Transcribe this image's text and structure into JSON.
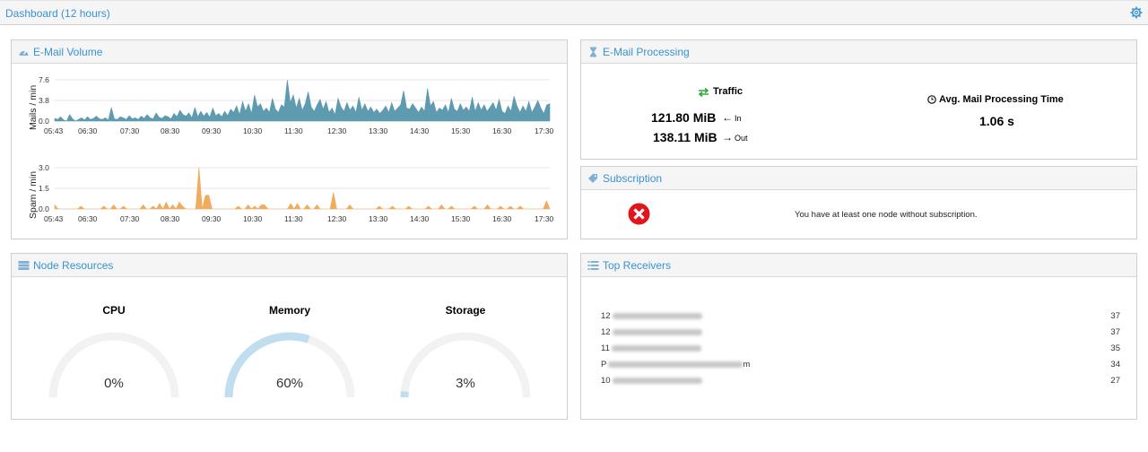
{
  "topbar": {
    "title": "Dashboard (12 hours)",
    "settings_icon": "gear-icon"
  },
  "panels": {
    "volume": {
      "title": "E-Mail Volume",
      "icon": "tachometer-icon"
    },
    "processing": {
      "title": "E-Mail Processing",
      "icon": "hourglass-icon"
    },
    "subscription": {
      "title": "Subscription",
      "icon": "ticket-icon"
    },
    "resources": {
      "title": "Node Resources",
      "icon": "server-icon"
    },
    "receivers": {
      "title": "Top Receivers",
      "icon": "list-icon"
    }
  },
  "chart_data": [
    {
      "type": "area",
      "ylabel": "Mails / min",
      "ylim": [
        0,
        7.6
      ],
      "yticks": [
        "7.6",
        "3.8",
        "0.0"
      ],
      "xticks": [
        "05:43",
        "06:30",
        "07:30",
        "08:30",
        "09:30",
        "10:30",
        "11:30",
        "12:30",
        "13:30",
        "14:30",
        "15:30",
        "16:30",
        "17:30"
      ],
      "color": "#5e9ab0",
      "values": [
        0.5,
        0.3,
        0.8,
        0.2,
        0.0,
        1.2,
        0.4,
        0.0,
        0.3,
        0.6,
        0.2,
        0.8,
        0.3,
        0.5,
        0.9,
        0.4,
        0.3,
        0.6,
        0.2,
        2.5,
        0.4,
        0.3,
        0.8,
        0.6,
        0.3,
        1.0,
        0.4,
        0.6,
        0.3,
        0.9,
        0.5,
        1.2,
        0.6,
        0.4,
        1.5,
        0.7,
        0.5,
        1.0,
        0.8,
        0.4,
        1.4,
        0.8,
        2.0,
        1.2,
        0.9,
        1.5,
        0.6,
        2.5,
        0.8,
        1.8,
        0.9,
        1.6,
        0.7,
        2.4,
        1.0,
        1.4,
        0.8,
        1.8,
        1.0,
        2.2,
        1.6,
        2.8,
        1.2,
        3.6,
        1.8,
        3.2,
        1.4,
        4.8,
        2.6,
        3.2,
        1.8,
        2.4,
        1.6,
        4.2,
        2.2,
        1.6,
        3.0,
        2.6,
        7.6,
        3.4,
        4.8,
        2.4,
        4.2,
        2.0,
        3.2,
        5.4,
        2.6,
        1.8,
        3.0,
        4.0,
        2.2,
        3.6,
        1.6,
        2.4,
        1.2,
        4.2,
        2.6,
        1.8,
        3.4,
        2.0,
        2.8,
        1.6,
        4.4,
        2.0,
        3.2,
        1.8,
        2.6,
        1.6,
        2.2,
        1.4,
        2.0,
        2.8,
        1.6,
        3.4,
        1.8,
        2.4,
        3.0,
        5.6,
        2.4,
        2.2,
        3.2,
        2.4,
        1.6,
        2.6,
        1.8,
        6.0,
        2.8,
        3.6,
        1.6,
        2.4,
        2.0,
        3.0,
        1.6,
        4.2,
        2.2,
        1.8,
        3.2,
        2.0,
        2.6,
        1.8,
        4.4,
        1.8,
        3.4,
        2.0,
        3.0,
        1.8,
        2.6,
        3.4,
        2.0,
        4.0,
        1.8,
        1.4,
        2.8,
        1.8,
        4.6,
        2.8,
        1.6,
        2.8,
        1.8,
        3.6,
        1.6,
        2.6,
        3.8,
        2.4,
        1.4,
        3.0,
        3.2
      ],
      "title": ""
    },
    {
      "type": "area",
      "ylabel": "Spam / min",
      "ylim": [
        0,
        3.0
      ],
      "yticks": [
        "3.0",
        "1.5",
        "0.0"
      ],
      "xticks": [
        "05:43",
        "06:30",
        "07:30",
        "08:30",
        "09:30",
        "10:30",
        "11:30",
        "12:30",
        "13:30",
        "14:30",
        "15:30",
        "16:30",
        "17:30"
      ],
      "color": "#f0ab5c",
      "values": [
        0.3,
        0,
        0,
        0,
        0,
        0,
        0,
        0,
        0.2,
        0,
        0,
        0,
        0,
        0,
        0,
        0.2,
        0,
        0,
        0.3,
        0,
        0,
        0.2,
        0,
        0,
        0,
        0,
        0,
        0.3,
        0,
        0,
        0.2,
        0,
        0.4,
        0,
        0.5,
        0,
        0.3,
        0,
        0.5,
        0.2,
        0,
        0,
        0,
        0,
        3.0,
        0,
        1.0,
        1.0,
        0,
        0,
        0,
        0,
        0,
        0,
        0,
        0,
        0.2,
        0,
        0,
        0.3,
        0,
        0.2,
        0,
        0.3,
        0.3,
        0,
        0,
        0,
        0,
        0,
        0,
        0,
        0.4,
        0,
        0.4,
        0,
        0,
        0.3,
        0,
        0,
        0.3,
        0,
        0,
        0,
        0,
        1.2,
        0,
        0,
        0,
        0,
        0.3,
        0,
        0,
        0,
        0,
        0,
        0,
        0,
        0,
        0.2,
        0,
        0,
        0,
        0.2,
        0,
        0,
        0,
        0,
        0.2,
        0,
        0,
        0,
        0,
        0,
        0.2,
        0,
        0,
        0,
        0.3,
        0,
        0,
        0.2,
        0,
        0,
        0,
        0,
        0,
        0,
        0.2,
        0,
        0,
        0,
        0.3,
        0,
        0,
        0,
        0.2,
        0,
        0,
        0.2,
        0,
        0,
        0.2,
        0,
        0,
        0,
        0,
        0,
        0,
        0,
        0.6,
        0
      ],
      "title": ""
    }
  ],
  "processing": {
    "traffic_label": "Traffic",
    "in_value": "121.80 MiB",
    "in_label": "In",
    "out_value": "138.11 MiB",
    "out_label": "Out",
    "avg_label": "Avg. Mail Processing Time",
    "avg_value": "1.06 s"
  },
  "subscription": {
    "message": "You have at least one node without subscription.",
    "status_icon": "error-x-icon"
  },
  "resources": {
    "gauges": [
      {
        "label": "CPU",
        "value": "0%",
        "fraction": 0.0
      },
      {
        "label": "Memory",
        "value": "60%",
        "fraction": 0.6
      },
      {
        "label": "Storage",
        "value": "3%",
        "fraction": 0.03
      }
    ],
    "track_color": "#f2f2f2",
    "fill_color": "#c1ddf0"
  },
  "receivers": [
    {
      "prefix": "12",
      "suffix": "",
      "count": "37"
    },
    {
      "prefix": "12",
      "suffix": "",
      "count": "37"
    },
    {
      "prefix": "11",
      "suffix": "",
      "count": "35"
    },
    {
      "prefix": "P",
      "suffix": "m",
      "count": "34"
    },
    {
      "prefix": "10",
      "suffix": "",
      "count": "27"
    }
  ]
}
